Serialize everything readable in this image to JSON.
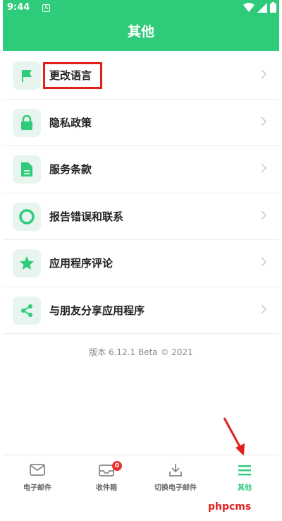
{
  "status_bar": {
    "time": "9:44",
    "notification_glyph": "A"
  },
  "header": {
    "title": "其他"
  },
  "menu": {
    "items": [
      {
        "label": "更改语言",
        "icon": "flag-icon"
      },
      {
        "label": "隐私政策",
        "icon": "lock-icon"
      },
      {
        "label": "服务条款",
        "icon": "document-icon"
      },
      {
        "label": "报告错误和联系",
        "icon": "lifebuoy-icon"
      },
      {
        "label": "应用程序评论",
        "icon": "star-icon"
      },
      {
        "label": "与朋友分享应用程序",
        "icon": "share-icon"
      }
    ]
  },
  "version_text": "版本 6.12.1 Beta © 2021",
  "tabbar": {
    "tabs": [
      {
        "label": "电子邮件",
        "icon": "mail-icon"
      },
      {
        "label": "收件箱",
        "icon": "inbox-icon",
        "badge": "0"
      },
      {
        "label": "切换电子邮件",
        "icon": "download-icon"
      },
      {
        "label": "其他",
        "icon": "menu-icon",
        "active": true
      }
    ]
  },
  "watermark": "phpcms",
  "colors": {
    "accent": "#2ecc7a",
    "highlight": "#e0201c",
    "icon_bg": "#e8f5ee"
  }
}
